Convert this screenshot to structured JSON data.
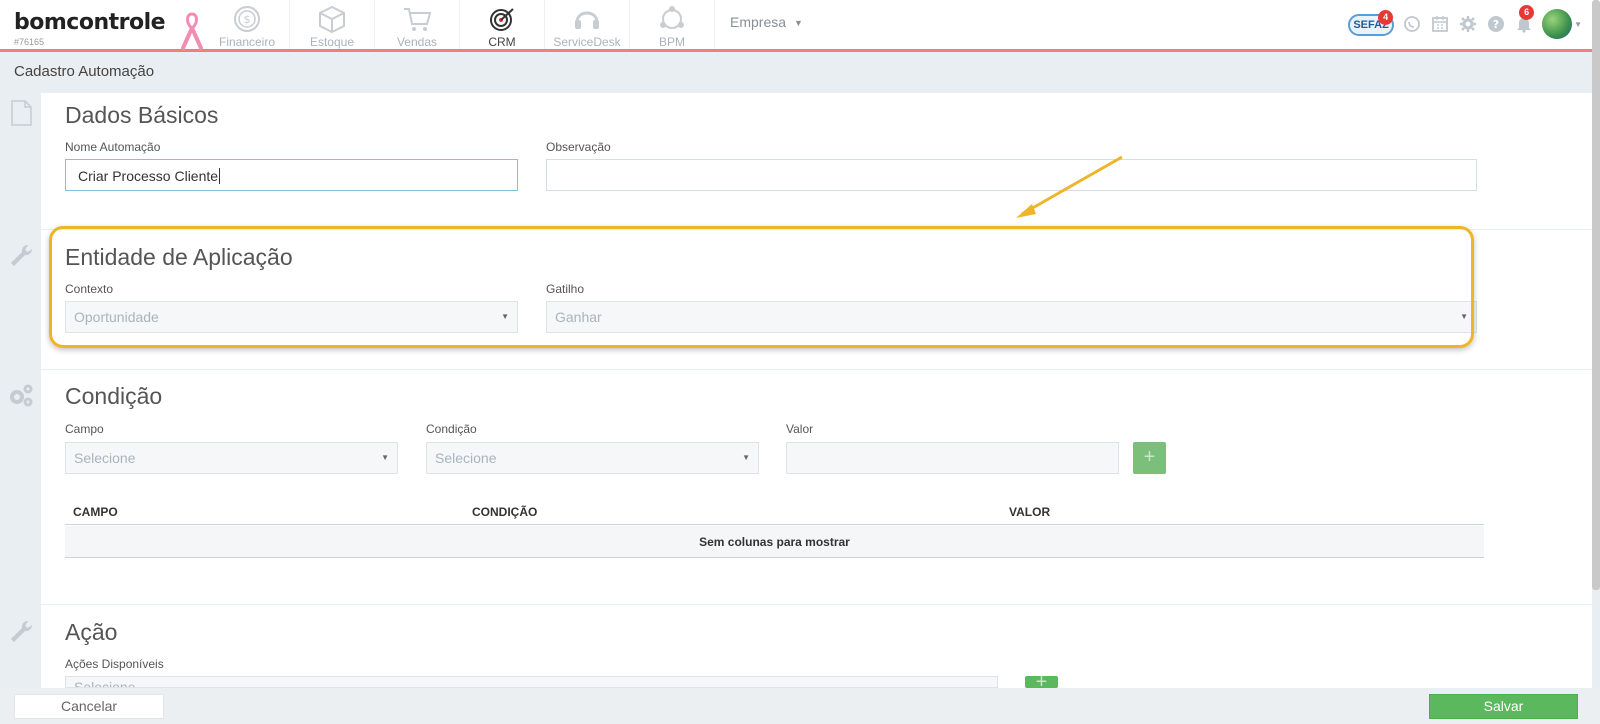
{
  "brand": {
    "logo_text": "bomcontrole",
    "account_id": "#76165"
  },
  "modules": [
    {
      "label": "Financeiro",
      "icon": "financeiro-icon"
    },
    {
      "label": "Estoque",
      "icon": "estoque-icon"
    },
    {
      "label": "Vendas",
      "icon": "vendas-icon"
    },
    {
      "label": "CRM",
      "icon": "crm-icon",
      "active": true
    },
    {
      "label": "ServiceDesk",
      "icon": "servicedesk-icon"
    },
    {
      "label": "BPM",
      "icon": "bpm-icon"
    }
  ],
  "company_menu": {
    "label": "Empresa",
    "caret": "▼"
  },
  "header_right": {
    "sefaz_label": "SEFAZ",
    "sefaz_badge": "4",
    "notifications_badge": "6"
  },
  "page": {
    "title": "Cadastro Automação"
  },
  "dados_basicos": {
    "title": "Dados Básicos",
    "nome_label": "Nome Automação",
    "nome_value": "Criar Processo Cliente",
    "obs_label": "Observação",
    "obs_value": ""
  },
  "entidade": {
    "title": "Entidade de Aplicação",
    "contexto_label": "Contexto",
    "contexto_value": "Oportunidade",
    "gatilho_label": "Gatilho",
    "gatilho_value": "Ganhar"
  },
  "condicao": {
    "title": "Condição",
    "campo_label": "Campo",
    "campo_value": "Selecione",
    "condicao_label": "Condição",
    "condicao_value": "Selecione",
    "valor_label": "Valor",
    "valor_value": "",
    "add_label": "+",
    "table_headers": [
      "CAMPO",
      "CONDIÇÃO",
      "VALOR"
    ],
    "empty_text": "Sem colunas para mostrar"
  },
  "acao": {
    "title": "Ação",
    "acoes_label": "Ações Disponíveis",
    "acoes_value": "Selecione",
    "add_label": "+"
  },
  "footer": {
    "cancel_label": "Cancelar",
    "save_label": "Salvar"
  },
  "colors": {
    "accent_border": "#f47c7c",
    "highlight": "#f0b429",
    "save": "#5cb85c"
  }
}
